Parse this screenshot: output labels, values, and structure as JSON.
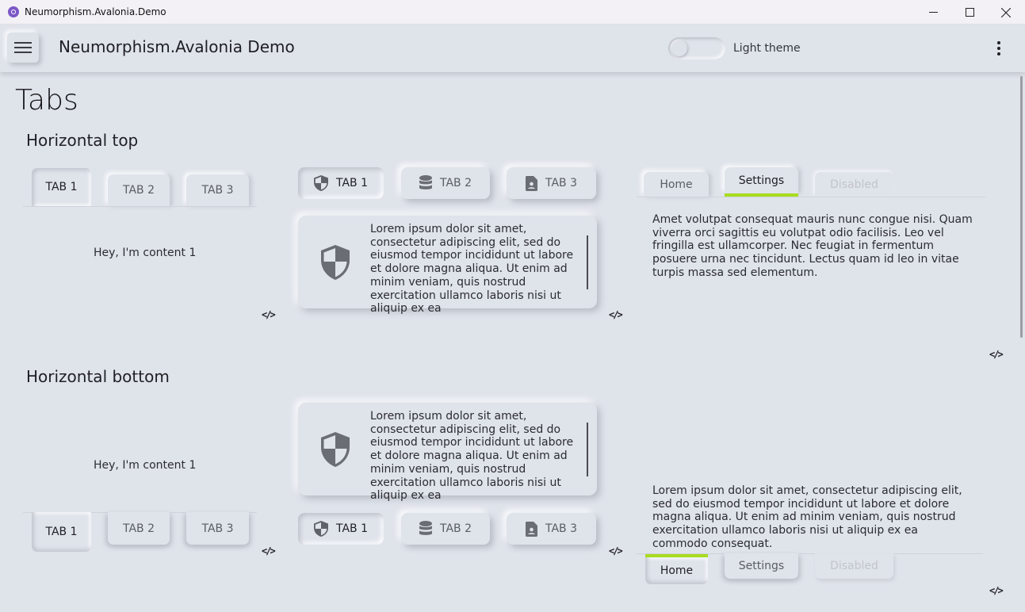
{
  "window": {
    "title": "Neumorphism.Avalonia.Demo",
    "minimize": "—",
    "maximize": "☐",
    "close": "✕"
  },
  "appbar": {
    "title": "Neumorphism.Avalonia Demo",
    "theme_label": "Light theme"
  },
  "page": {
    "title": "Tabs"
  },
  "sections": {
    "top": "Horizontal top",
    "bottom": "Horizontal bottom"
  },
  "simple_tabs": {
    "labels": [
      "TAB 1",
      "TAB 2",
      "TAB 3"
    ],
    "content": "Hey, I'm content 1"
  },
  "icon_tabs": {
    "labels": [
      "TAB 1",
      "TAB 2",
      "TAB 3"
    ],
    "icons": [
      "shield-icon",
      "database-icon",
      "file-account-icon"
    ]
  },
  "card_text": "Lorem ipsum dolor sit amet, consectetur adipiscing elit, sed do eiusmod tempor incididunt ut labore et dolore magna aliqua. Ut enim ad minim veniam, quis nostrud exercitation ullamco laboris nisi ut aliquip ex ea",
  "text_tabs": {
    "labels": [
      "Home",
      "Settings",
      "Disabled"
    ]
  },
  "top_right_content": "Amet volutpat consequat mauris nunc congue nisi. Quam viverra orci sagittis eu volutpat odio facilisis. Leo vel fringilla est ullamcorper. Nec feugiat in fermentum posuere urna nec tincidunt. Lectus quam id leo in vitae turpis massa sed elementum.",
  "bottom_right_content": "Lorem ipsum dolor sit amet, consectetur adipiscing elit, sed do eiusmod tempor incididunt ut labore et dolore magna aliqua. Ut enim ad minim veniam, quis nostrud exercitation ullamco laboris nisi ut aliquip ex ea commodo consequat.",
  "code_icon": "</>",
  "colors": {
    "background": "#dfe3ea",
    "accent": "#a8dc1e",
    "disabled": "#c2c5cb"
  }
}
